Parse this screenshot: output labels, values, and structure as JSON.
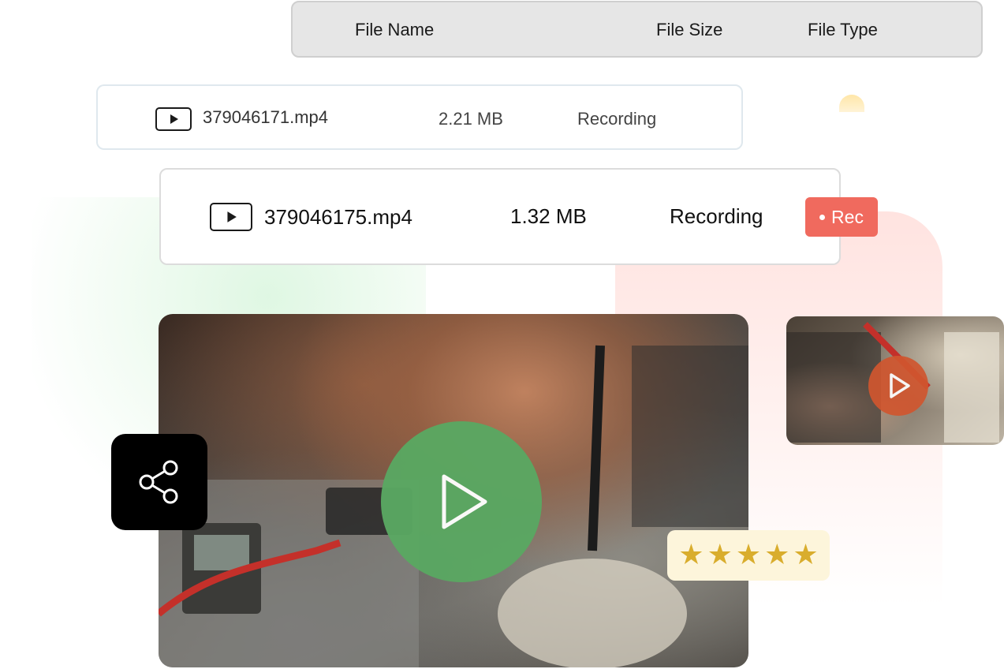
{
  "table": {
    "headers": [
      "File Name",
      "File Size",
      "File Type"
    ],
    "rows": [
      {
        "name": "379046171.mp4",
        "size": "2.21 MB",
        "type": "Recording"
      },
      {
        "name": "379046175.mp4",
        "size": "1.32 MB",
        "type": "Recording"
      }
    ]
  },
  "badge": {
    "label": "Rec",
    "color": "#f06a5e"
  },
  "rating": {
    "value": 5,
    "max": 5,
    "color": "#d9ad2d"
  },
  "colors": {
    "header_bg": "#e6e6e6",
    "main_play_bg": "#5aa862",
    "small_play_bg": "#d0562f",
    "share_tile_bg": "#000000"
  },
  "icons": {
    "row_icon": "video-file-icon",
    "main_play": "play-icon",
    "small_play": "play-icon",
    "share": "share-icon",
    "rating": "star-icon"
  }
}
